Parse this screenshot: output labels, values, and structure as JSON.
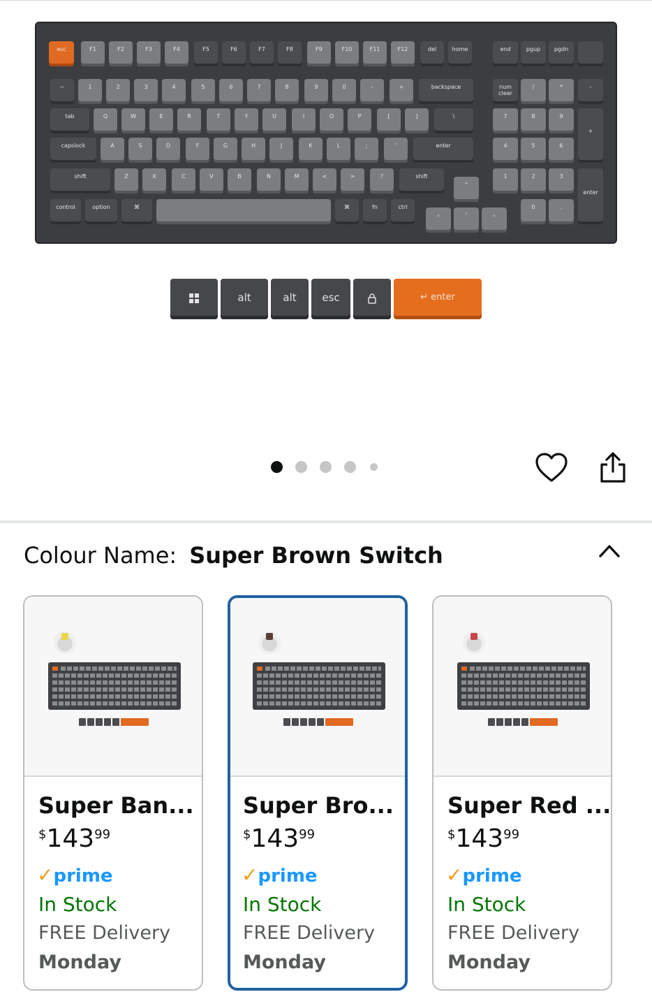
{
  "keyboard": {
    "fn_row": [
      "esc",
      "F1",
      "F2",
      "F3",
      "F4",
      "F5",
      "F6",
      "F7",
      "F8",
      "F9",
      "F10",
      "F11",
      "F12",
      "del",
      "home"
    ],
    "nav_cluster": [
      "end",
      "pgup",
      "pgdn"
    ],
    "number_row": [
      "~",
      "1",
      "2",
      "3",
      "4",
      "5",
      "6",
      "7",
      "8",
      "9",
      "0",
      "-",
      "+",
      "backspace"
    ],
    "numpad_top": [
      "num clear",
      "/",
      "*",
      "-"
    ],
    "qwerty_row": [
      "tab",
      "Q",
      "W",
      "E",
      "R",
      "T",
      "Y",
      "U",
      "I",
      "O",
      "P",
      "[",
      "]",
      "\\"
    ],
    "home_row": [
      "capslock",
      "A",
      "S",
      "D",
      "F",
      "G",
      "H",
      "J",
      "K",
      "L",
      ";",
      "'",
      "enter"
    ],
    "shift_row": [
      "shift",
      "Z",
      "X",
      "C",
      "V",
      "B",
      "N",
      "M",
      "<",
      ">",
      "?",
      "shift"
    ],
    "bottom_row": [
      "control",
      "option",
      "⌘",
      "⌘",
      "fn",
      "ctrl"
    ],
    "numpad": [
      "7",
      "8",
      "9",
      "4",
      "5",
      "6",
      "1",
      "2",
      "3",
      "0",
      ".",
      "+",
      "enter"
    ],
    "arrows": [
      "^",
      "‹",
      "˅",
      "›"
    ]
  },
  "extra_keys": [
    "alt",
    "alt",
    "esc",
    "↵ enter"
  ],
  "carousel": {
    "total": 5,
    "active": 0
  },
  "colour": {
    "label": "Colour Name:",
    "value": "Super Brown Switch"
  },
  "variants": [
    {
      "title": "Super Ban...",
      "currency": "$",
      "price_whole": "143",
      "price_fraction": "99",
      "prime_word": "prime",
      "stock": "In Stock",
      "delivery": "FREE Delivery",
      "day": "Monday",
      "switch_color": "#e8d84a",
      "selected": false
    },
    {
      "title": "Super Bro...",
      "currency": "$",
      "price_whole": "143",
      "price_fraction": "99",
      "prime_word": "prime",
      "stock": "In Stock",
      "delivery": "FREE Delivery",
      "day": "Monday",
      "switch_color": "#5a3e36",
      "selected": true
    },
    {
      "title": "Super Red ...",
      "currency": "$",
      "price_whole": "143",
      "price_fraction": "99",
      "prime_word": "prime",
      "stock": "In Stock",
      "delivery": "FREE Delivery",
      "day": "Monday",
      "switch_color": "#c8464b",
      "selected": false
    }
  ],
  "icons": {
    "wishlist": "heart-icon",
    "share": "share-icon",
    "collapse": "chevron-up-icon"
  },
  "colors": {
    "accent_selected": "#2162a1",
    "stock_green": "#007600",
    "prime_blue": "#1a98ff",
    "keyboard_orange": "#e06a21"
  }
}
